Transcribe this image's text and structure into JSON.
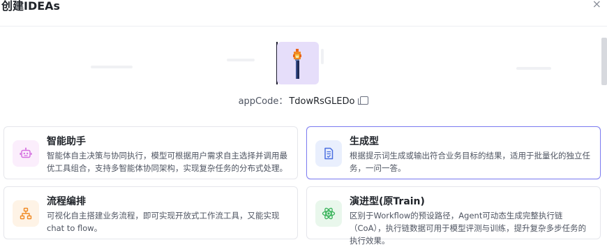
{
  "dialog": {
    "title": "创建IDEAs",
    "close_symbol": "×"
  },
  "app": {
    "code_label": "appCode：",
    "code_value": "TdowRsGLEDo"
  },
  "cards": [
    {
      "title": "智能助手",
      "description": "智能体自主决策与协同执行，模型可根据用户需求自主选择并调用最优工具组合，支持多智能体协同架构，实现复杂任务的分布式处理。",
      "icon": "robot-icon",
      "color": "#d56fe0"
    },
    {
      "title": "生成型",
      "description": "根据提示词生成或输出符合业务目标的结果，适用于批量化的独立任务，一问一答。",
      "icon": "document-check-icon",
      "color": "#4a6fe0",
      "selected": true
    },
    {
      "title": "流程编排",
      "description": "可视化自主搭建业务流程，即可实现开放式工作流工具，又能实现chat to flow。",
      "icon": "flow-chart-icon",
      "color": "#f08a24"
    },
    {
      "title": "演进型(原Train)",
      "description": "区别于Workflow的预设路径，Agent可动态生成完整执行链（CoA），执行链数据可用于模型评测与训练，提升复杂多步任务的执行效果。",
      "icon": "atom-icon",
      "color": "#38b35a"
    }
  ]
}
